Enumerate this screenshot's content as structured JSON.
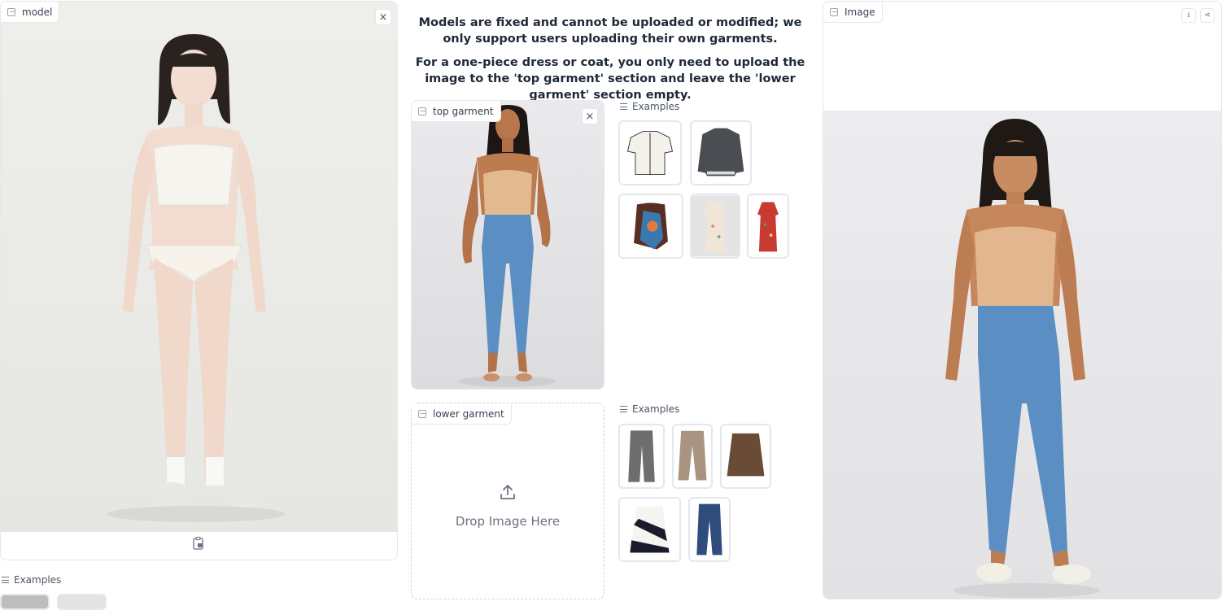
{
  "model_panel": {
    "label": "model",
    "close_icon": "×",
    "paste_icon": "clipboard-icon"
  },
  "model_examples": {
    "label": "Examples"
  },
  "notice": {
    "line1": "Models are fixed and cannot be uploaded or modified; we only support users uploading their own garments.",
    "line2": "For a one-piece dress or coat, you only need to upload the image to the 'top garment' section and leave the 'lower garment' section empty."
  },
  "top_garment": {
    "label": "top garment",
    "close_icon": "×"
  },
  "top_examples": {
    "label": "Examples"
  },
  "lower_garment": {
    "label": "lower garment",
    "drop_text": "Drop Image Here"
  },
  "lower_examples": {
    "label": "Examples"
  },
  "output_panel": {
    "label": "Image",
    "download_icon": "download-icon",
    "share_icon": "share-icon"
  },
  "colors": {
    "border": "#e5e7eb",
    "denim": "#5b8fc4",
    "skin": "#c98a5a",
    "corset": "#e3b990",
    "model_skin": "#f2dcd0"
  }
}
